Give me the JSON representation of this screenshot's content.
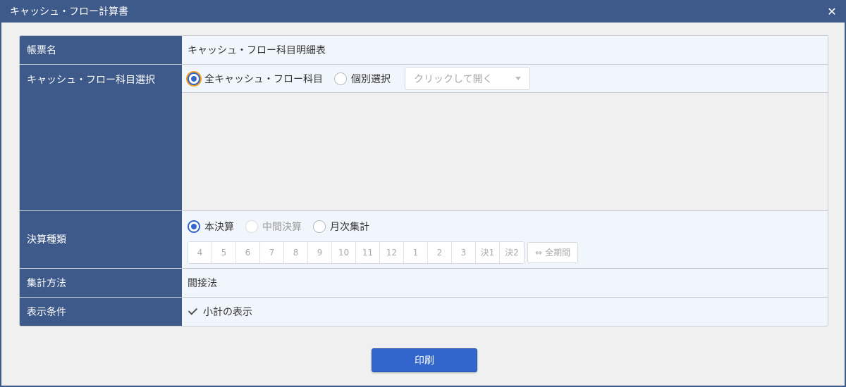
{
  "window": {
    "title": "キャッシュ・フロー計算書",
    "close_icon": "close-icon"
  },
  "form": {
    "report_name": {
      "label": "帳票名",
      "value": "キャッシュ・フロー科目明細表"
    },
    "cf_item_selection": {
      "label": "キャッシュ・フロー科目選択",
      "options": [
        "全キャッシュ・フロー科目",
        "個別選択"
      ],
      "selected": "全キャッシュ・フロー科目",
      "dropdown_placeholder": "クリックして開く"
    },
    "settlement_type": {
      "label": "決算種類",
      "options": [
        "本決算",
        "中間決算",
        "月次集計"
      ],
      "selected": "本決算",
      "months": [
        "4",
        "5",
        "6",
        "7",
        "8",
        "9",
        "10",
        "11",
        "12",
        "1",
        "2",
        "3",
        "決1",
        "決2"
      ],
      "all_period": "全期間"
    },
    "aggregation_method": {
      "label": "集計方法",
      "value": "間接法"
    },
    "display_condition": {
      "label": "表示条件",
      "checkbox_label": "小計の表示",
      "checked": true
    }
  },
  "actions": {
    "print_label": "印刷"
  },
  "colors": {
    "header": "#3e5a8a",
    "accent": "#3366cc",
    "value_bg": "#f0f6fc"
  }
}
